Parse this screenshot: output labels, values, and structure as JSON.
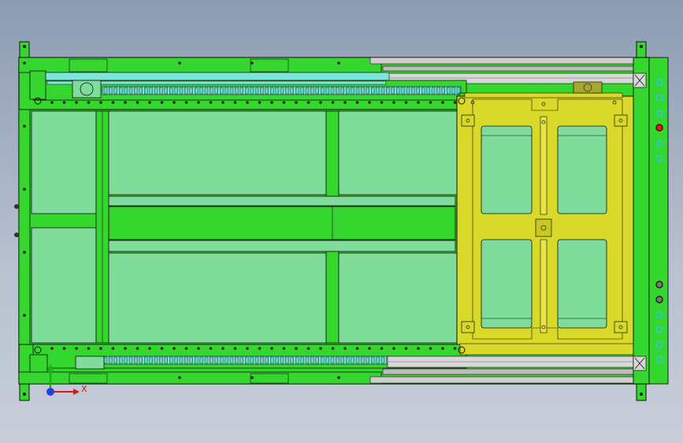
{
  "viewport": {
    "background_top": "#8d9cb2",
    "background_bottom": "#c7ced9"
  },
  "colors": {
    "frame_green": "#35d72f",
    "frame_dark_green": "#1f9d1a",
    "panel_green": "#7fdc9a",
    "plate_yellow": "#d9d92a",
    "plate_dark_yellow": "#a6a610",
    "rail_gray": "#c9c9c9",
    "cyan_strip": "#7ce7d9",
    "outline": "#111111",
    "axis_x": "#e01515",
    "axis_y": "#18b318",
    "axis_z": "#1f3fe0",
    "indicator_cyan": "#2cc7e6",
    "indicator_red": "#d42020"
  },
  "icons": [
    "mounting-bracket-icon",
    "bolt-icon",
    "triad-axes-icon",
    "indicator-light-icon"
  ],
  "triad": {
    "x_label": "X"
  }
}
